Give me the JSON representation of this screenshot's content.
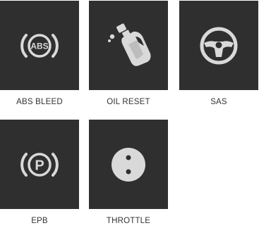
{
  "colors": {
    "tile_background": "#2f2f2f",
    "icon": "#d9d9d9",
    "label_text": "#333333",
    "page_background": "#ffffff"
  },
  "tiles": [
    {
      "label": "ABS BLEED",
      "icon": "abs-warning-icon",
      "badge_text": "ABS"
    },
    {
      "label": "OIL RESET",
      "icon": "oil-can-icon"
    },
    {
      "label": "SAS",
      "icon": "steering-wheel-icon"
    },
    {
      "label": "EPB",
      "icon": "parking-brake-icon",
      "badge_text": "P"
    },
    {
      "label": "THROTTLE",
      "icon": "throttle-valve-icon"
    }
  ]
}
